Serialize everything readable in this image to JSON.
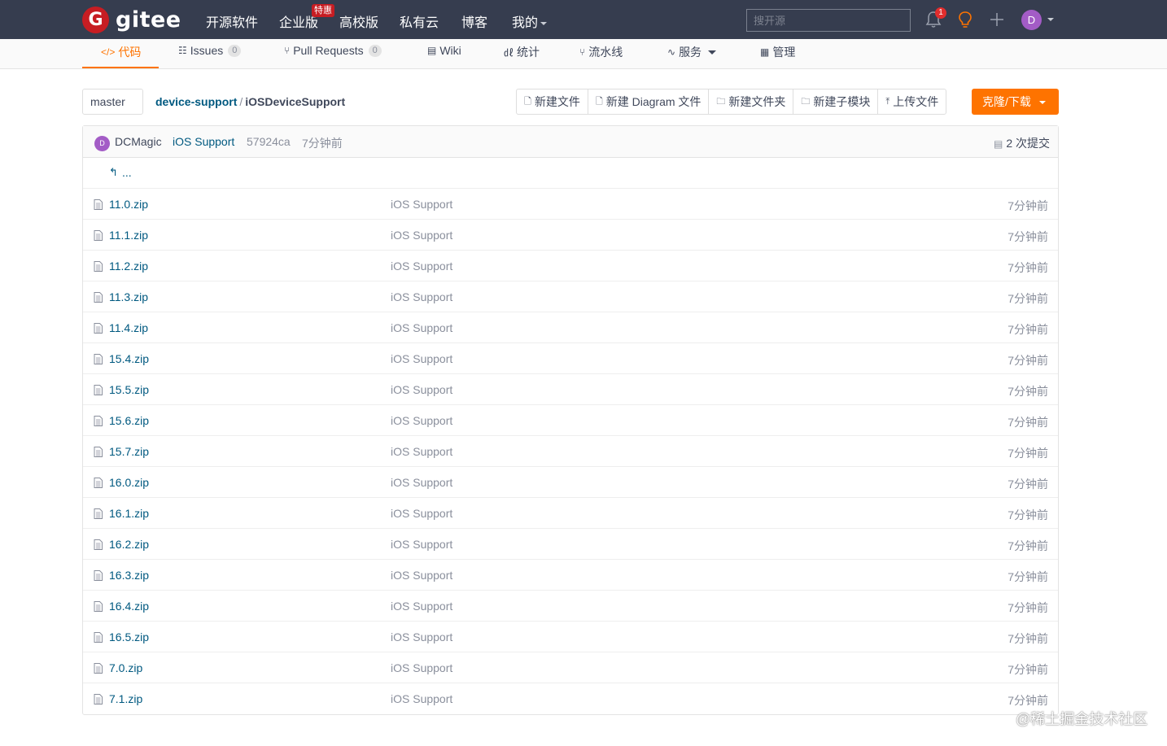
{
  "header": {
    "logo_letter": "G",
    "logo_text": "gitee",
    "nav": [
      "开源软件",
      "企业版",
      "高校版",
      "私有云",
      "博客",
      "我的"
    ],
    "promo_badge": "特惠",
    "search_placeholder": "搜开源",
    "notification_count": "1",
    "avatar_letter": "D"
  },
  "tabs": [
    {
      "icon": "</>",
      "label": "代码",
      "count": ""
    },
    {
      "icon": "☷",
      "label": "Issues",
      "count": "0"
    },
    {
      "icon": "⑂",
      "label": "Pull Requests",
      "count": "0"
    },
    {
      "icon": "▤",
      "label": "Wiki",
      "count": ""
    },
    {
      "icon": "㎗",
      "label": "统计",
      "count": ""
    },
    {
      "icon": "⑂",
      "label": "流水线",
      "count": ""
    },
    {
      "icon": "∿",
      "label": "服务",
      "count": ""
    },
    {
      "icon": "▦",
      "label": "管理",
      "count": ""
    }
  ],
  "toolbar": {
    "branch": "master",
    "repo": "device-support",
    "separator": "/",
    "current_dir": "iOSDeviceSupport",
    "actions": [
      "新建文件",
      "新建 Diagram 文件",
      "新建文件夹",
      "新建子模块",
      "上传文件"
    ],
    "clone_label": "克隆/下载"
  },
  "commit": {
    "avatar_letter": "D",
    "author": "DCMagic",
    "message": "iOS Support",
    "sha": "57924ca",
    "time": "7分钟前",
    "count_label": "2 次提交"
  },
  "up_row_text": "...",
  "files": [
    {
      "name": "11.0.zip",
      "message": "iOS Support",
      "time": "7分钟前"
    },
    {
      "name": "11.1.zip",
      "message": "iOS Support",
      "time": "7分钟前"
    },
    {
      "name": "11.2.zip",
      "message": "iOS Support",
      "time": "7分钟前"
    },
    {
      "name": "11.3.zip",
      "message": "iOS Support",
      "time": "7分钟前"
    },
    {
      "name": "11.4.zip",
      "message": "iOS Support",
      "time": "7分钟前"
    },
    {
      "name": "15.4.zip",
      "message": "iOS Support",
      "time": "7分钟前"
    },
    {
      "name": "15.5.zip",
      "message": "iOS Support",
      "time": "7分钟前"
    },
    {
      "name": "15.6.zip",
      "message": "iOS Support",
      "time": "7分钟前"
    },
    {
      "name": "15.7.zip",
      "message": "iOS Support",
      "time": "7分钟前"
    },
    {
      "name": "16.0.zip",
      "message": "iOS Support",
      "time": "7分钟前"
    },
    {
      "name": "16.1.zip",
      "message": "iOS Support",
      "time": "7分钟前"
    },
    {
      "name": "16.2.zip",
      "message": "iOS Support",
      "time": "7分钟前"
    },
    {
      "name": "16.3.zip",
      "message": "iOS Support",
      "time": "7分钟前"
    },
    {
      "name": "16.4.zip",
      "message": "iOS Support",
      "time": "7分钟前"
    },
    {
      "name": "16.5.zip",
      "message": "iOS Support",
      "time": "7分钟前"
    },
    {
      "name": "7.0.zip",
      "message": "iOS Support",
      "time": "7分钟前"
    },
    {
      "name": "7.1.zip",
      "message": "iOS Support",
      "time": "7分钟前"
    }
  ],
  "watermark": "@稀土掘金技术社区",
  "colors": {
    "accent": "#fe7300",
    "link": "#005980",
    "topbar": "#363d4f",
    "brand_red": "#c71d23"
  }
}
